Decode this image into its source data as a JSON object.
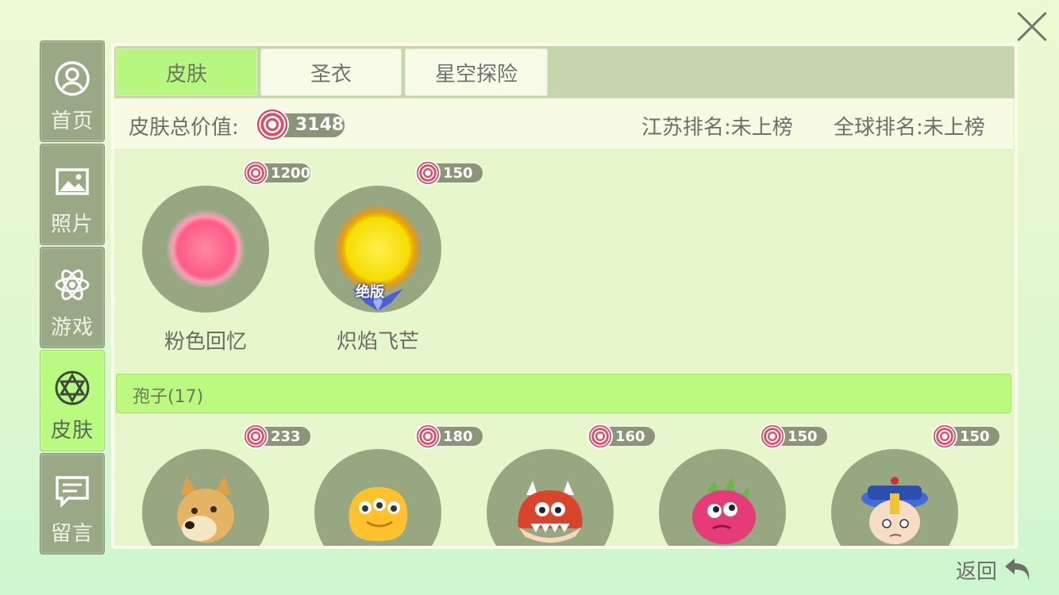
{
  "sidebar": {
    "items": [
      {
        "label": "首页",
        "icon": "user-icon"
      },
      {
        "label": "照片",
        "icon": "image-icon"
      },
      {
        "label": "游戏",
        "icon": "atom-icon"
      },
      {
        "label": "皮肤",
        "icon": "skin-icon",
        "active": true
      },
      {
        "label": "留言",
        "icon": "message-icon"
      }
    ]
  },
  "tabs": [
    {
      "label": "皮肤",
      "active": true
    },
    {
      "label": "圣衣",
      "active": false
    },
    {
      "label": "星空探险",
      "active": false
    }
  ],
  "summary": {
    "total_label": "皮肤总价值:",
    "total_value": "3148",
    "province_rank": "江苏排名:未上榜",
    "global_rank": "全球排名:未上榜"
  },
  "featured": [
    {
      "name": "粉色回忆",
      "price": "1200",
      "icon": "pink-orb"
    },
    {
      "name": "炽焰飞芒",
      "price": "150",
      "icon": "golden-orb",
      "badge": "绝版"
    }
  ],
  "section": {
    "title": "孢子(17)"
  },
  "spores": [
    {
      "price": "233",
      "icon": "doge-face"
    },
    {
      "price": "180",
      "icon": "yellow-blob"
    },
    {
      "price": "160",
      "icon": "red-monster"
    },
    {
      "price": "150",
      "icon": "dragonfruit"
    },
    {
      "price": "150",
      "icon": "qing-jiangshi"
    }
  ],
  "back": {
    "label": "返回"
  },
  "colors": {
    "accent": "#b9fa80",
    "sidebar": "#99a986",
    "coin": "#e64a63"
  }
}
